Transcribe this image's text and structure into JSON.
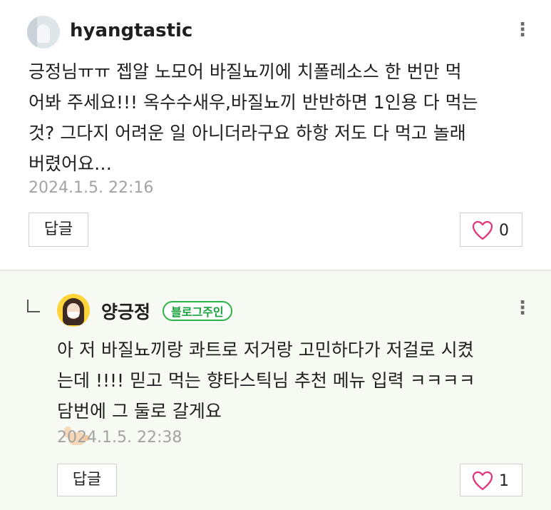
{
  "comments": [
    {
      "username": "hyangtastic",
      "lines": [
        "긍정님ㅠㅠ 젭알 노모어 바질뇨끼에 치폴레소스 한 번만 먹",
        "어봐 주세요!!! 옥수수새우,바질뇨끼 반반하면 1인용 다 먹는",
        "것? 그다지 어려운 일 아니더라구요 하항 저도 다 먹고 놀래",
        "버렸어요…"
      ],
      "timestamp": "2024.1.5. 22:16",
      "reply_label": "답글",
      "like_count": "0"
    },
    {
      "username": "양긍정",
      "badge": "블로그주인",
      "lines": [
        "아 저 바질뇨끼랑 콰트로 저거랑 고민하다가 저걸로 시켰",
        "는데 !!!! 믿고 먹는 향타스틱님 추천 메뉴 입력 ㅋㅋㅋㅋ",
        "담번에 그 둘로 갈게요"
      ],
      "timestamp": "2024.1.5. 22:38",
      "reply_label": "답글",
      "like_count": "1"
    }
  ],
  "icons": {
    "more": "more-vertical-icon",
    "like": "heart-outline-icon",
    "reply_indicator": "reply-arrow-icon",
    "emoji": "call-me-hand-emoji"
  },
  "colors": {
    "badge_green": "#29b449",
    "heart_pink": "#e0337a",
    "reply_background": "#f7faf2",
    "timestamp_gray": "#a3a3a3"
  }
}
